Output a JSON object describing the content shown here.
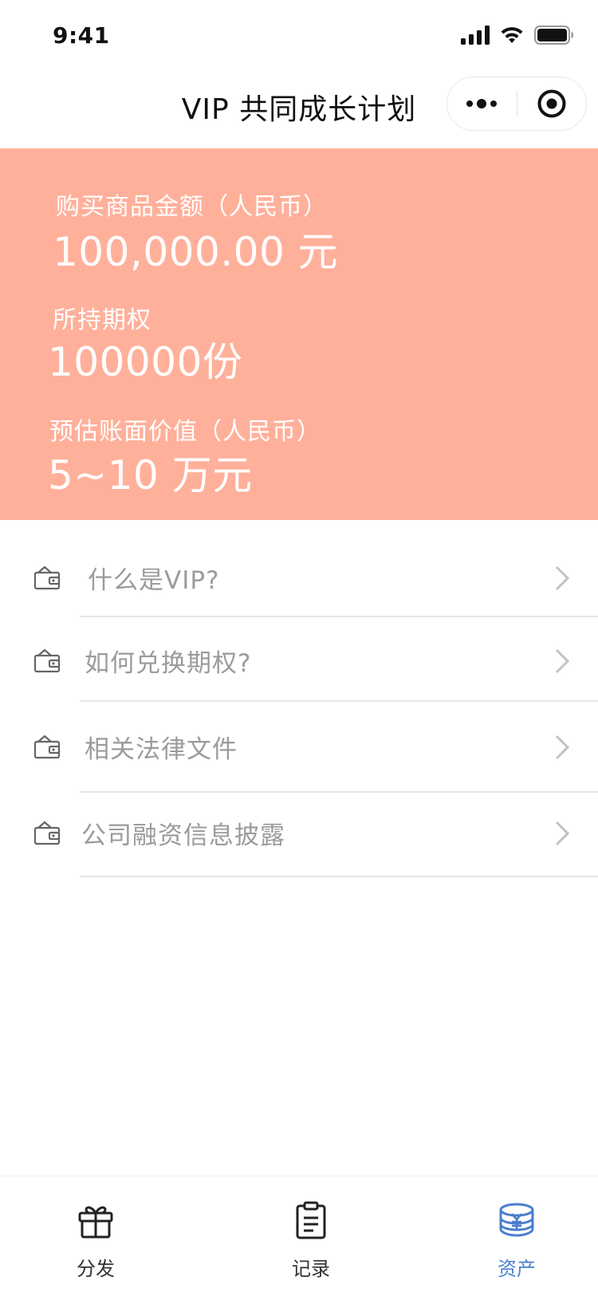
{
  "status_bar": {
    "time": "9:41"
  },
  "header": {
    "title": "VIP  共同成长计划",
    "more_icon": "more-dots-icon",
    "close_icon": "target-circle-icon"
  },
  "summary": {
    "purchase_label": "购买商品金额（人民币）",
    "purchase_value": "100,000.00 元",
    "options_label": "所持期权",
    "options_value": "100000份",
    "estimate_label": "预估账面价值（人民币）",
    "estimate_value": "5~10 万元",
    "background_color": "#ffb09b"
  },
  "menu": {
    "items": [
      {
        "label": "什么是VIP?",
        "icon": "wallet-icon"
      },
      {
        "label": "如何兑换期权?",
        "icon": "wallet-icon"
      },
      {
        "label": "相关法律文件",
        "icon": "wallet-icon"
      },
      {
        "label": "公司融资信息披露",
        "icon": "wallet-icon"
      }
    ]
  },
  "tab_bar": {
    "tabs": [
      {
        "label": "分发",
        "icon": "gift-icon",
        "active": false
      },
      {
        "label": "记录",
        "icon": "clipboard-icon",
        "active": false
      },
      {
        "label": "资产",
        "icon": "coin-stack-icon",
        "active": true
      }
    ],
    "active_color": "#4a7fce"
  }
}
